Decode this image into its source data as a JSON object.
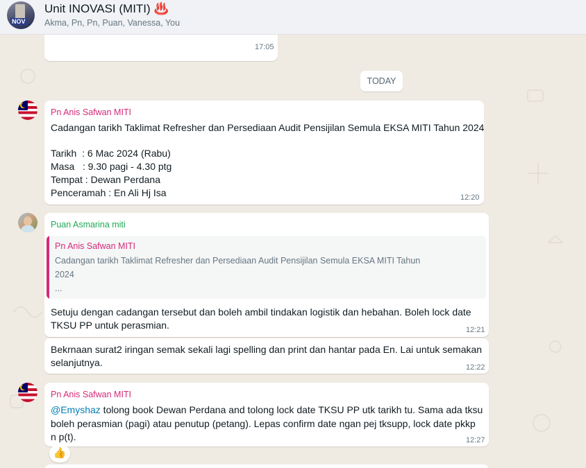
{
  "header": {
    "title": "Unit INOVASI (MITI)",
    "title_emoji": "♨️",
    "members": "Akma, Pn, Pn, Puan, Vanessa, You",
    "avatar_tag": "NOV"
  },
  "chat": {
    "top_message": {
      "time": "17:05"
    },
    "date_divider": "TODAY",
    "messages": [
      {
        "sender": "Pn Anis Safwan MITI",
        "sender_color": "#d42a78",
        "lines": [
          "Cadangan tarikh Taklimat Refresher dan Persediaan Audit Pensijilan Semula EKSA MITI Tahun 2024",
          "Tarikh  : 6 Mac 2024 (Rabu)",
          "Masa   : 9.30 pagi - 4.30 ptg",
          "Tempat : Dewan Perdana",
          "Penceramah : En Ali Hj Isa"
        ],
        "time": "12:20"
      },
      {
        "sender": "Puan Asmarina miti",
        "sender_color": "#1fa855",
        "quote": {
          "sender": "Pn Anis Safwan MITI",
          "lines": [
            "Cadangan tarikh Taklimat Refresher dan Persediaan Audit Pensijilan Semula EKSA MITI Tahun",
            "2024",
            "..."
          ]
        },
        "lines": [
          "Setuju dengan cadangan tersebut dan boleh ambil tindakan logistik dan hebahan. Boleh lock date",
          "TKSU PP untuk perasmian."
        ],
        "time": "12:21"
      },
      {
        "lines": [
          "Bekrnaan surat2 iringan semak sekali lagi spelling dan print dan hantar pada En. Lai untuk semakan",
          "selanjutnya."
        ],
        "time": "12:22"
      },
      {
        "sender": "Pn Anis Safwan MITI",
        "sender_color": "#d42a78",
        "mention": "@Emyshaz",
        "lines": [
          " tolong book Dewan Perdana and tolong lock date TKSU PP utk tarikh tu. Sama ada tksu",
          "boleh perasmian (pagi) atau penutup (petang). Lepas confirm date ngan pej tksupp, lock date pkkp",
          "n p(t)."
        ],
        "time": "12:27",
        "reaction": "👍"
      }
    ]
  }
}
